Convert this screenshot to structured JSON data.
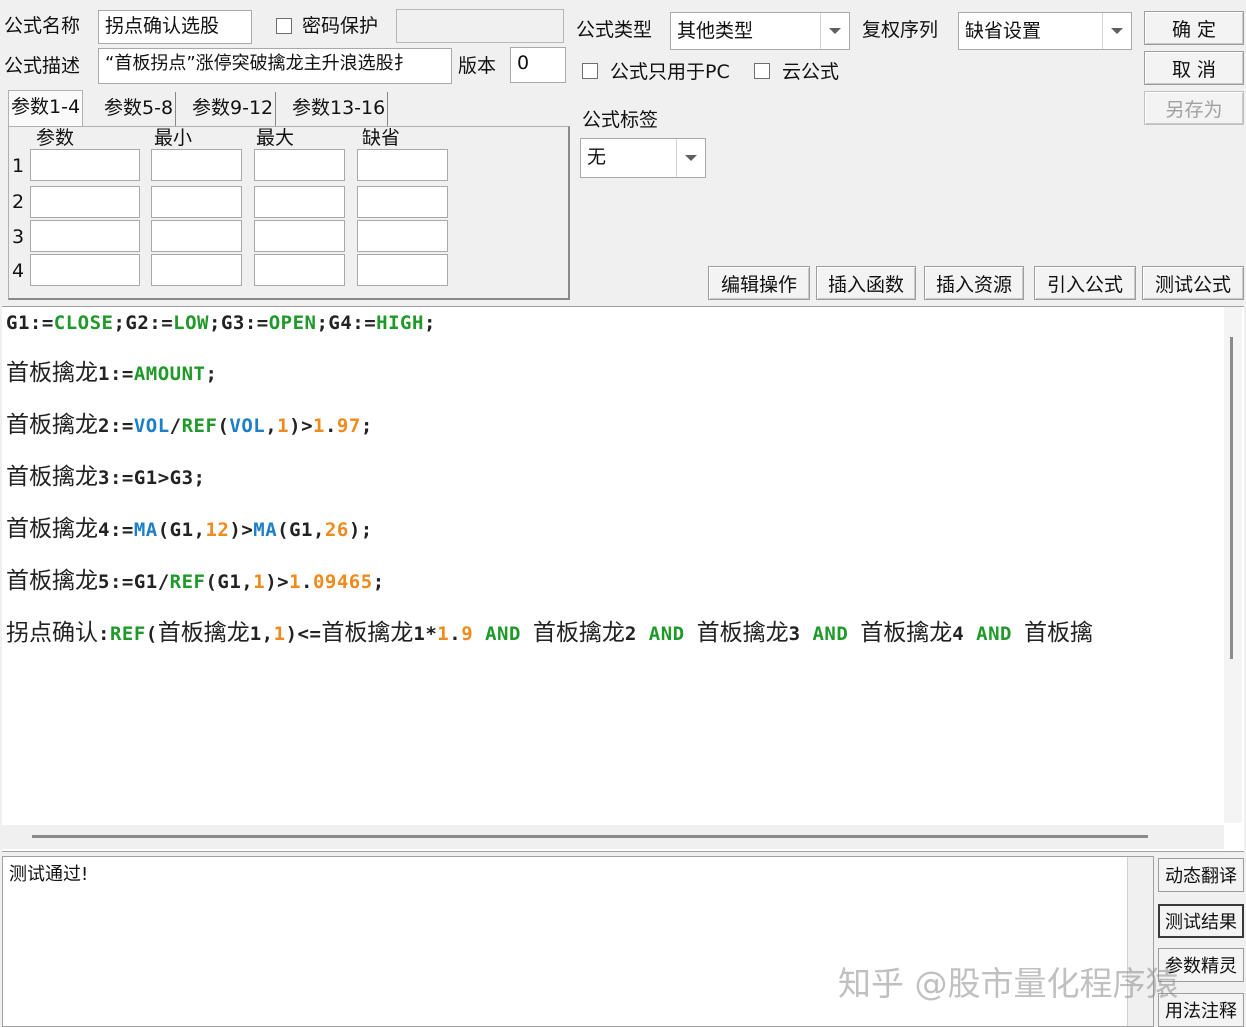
{
  "form": {
    "name_label": "公式名称",
    "name_value": "拐点确认选股",
    "password_label": "密码保护",
    "password_value": "",
    "desc_label": "公式描述",
    "desc_value": "“首板拐点”涨停突破擒龙主升浪选股扌",
    "version_label": "版本",
    "version_value": "0",
    "type_label": "公式类型",
    "type_value": "其他类型",
    "restore_label": "复权序列",
    "restore_value": "缺省设置",
    "pc_only_label": "公式只用于PC",
    "cloud_label": "云公式",
    "tag_label": "公式标签",
    "tag_value": "无"
  },
  "buttons": {
    "ok": "确  定",
    "cancel": "取  消",
    "save_as": "另存为",
    "edit_ops": "编辑操作",
    "insert_func": "插入函数",
    "insert_res": "插入资源",
    "import_formula": "引入公式",
    "test_formula": "测试公式"
  },
  "params": {
    "tabs": [
      "参数1-4",
      "参数5-8",
      "参数9-12",
      "参数13-16"
    ],
    "headers": [
      "参数",
      "最小",
      "最大",
      "缺省"
    ],
    "rows": [
      "1",
      "2",
      "3",
      "4"
    ]
  },
  "code": {
    "l1": [
      "G1:=",
      "CLOSE",
      ";G2:=",
      "LOW",
      ";G3:=",
      "OPEN",
      ";G4:=",
      "HIGH",
      ";"
    ],
    "l2": [
      "首板擒龙",
      "1:=",
      "AMOUNT",
      ";"
    ],
    "l3": [
      "首板擒龙",
      "2:=",
      "VOL",
      "/",
      "REF",
      "(",
      "VOL",
      ",",
      "1",
      ")>",
      "1",
      ".",
      "97",
      ";"
    ],
    "l4": [
      "首板擒龙",
      "3:=G1>G3;"
    ],
    "l5": [
      "首板擒龙",
      "4:=",
      "MA",
      "(G1,",
      "12",
      ")>",
      "MA",
      "(G1,",
      "26",
      ");"
    ],
    "l6": [
      "首板擒龙",
      "5:=G1/",
      "REF",
      "(G1,",
      "1",
      ")>",
      "1",
      ".",
      "09465",
      ";"
    ],
    "l7": [
      "拐点确认",
      ":",
      "REF",
      "(",
      "首板擒龙",
      "1,",
      "1",
      ")<=",
      "首板擒龙",
      "1*",
      "1",
      ".",
      "9",
      " ",
      "AND",
      " ",
      "首板擒龙",
      "2",
      " ",
      "AND",
      " ",
      "首板擒龙",
      "3",
      " ",
      "AND",
      " ",
      "首板擒龙",
      "4",
      " ",
      "AND",
      " ",
      "首板擒"
    ]
  },
  "output": {
    "text": "测试通过!"
  },
  "side_buttons": {
    "translate": "动态翻译",
    "result": "测试结果",
    "wizard": "参数精灵",
    "annotate": "用法注释"
  },
  "watermark": "知乎 @股市量化程序猿"
}
